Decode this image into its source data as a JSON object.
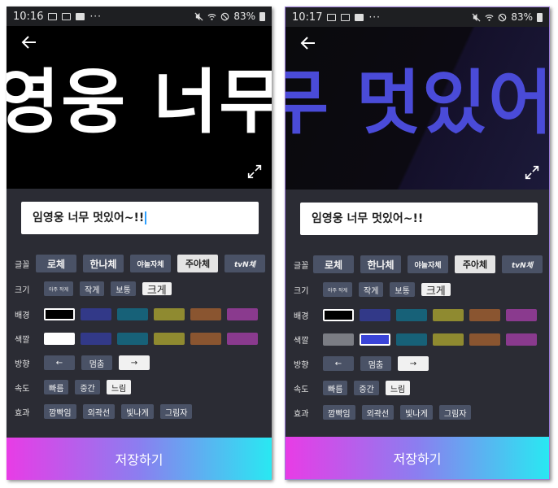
{
  "screens": [
    {
      "status_time": "10:16",
      "status_dots": "···",
      "battery": "83%",
      "preview_text": "영웅 너무",
      "input_value": "임영웅 너무 멋있어~!!",
      "rows": {
        "font_label": "글꼴",
        "size_label": "크기",
        "bg_label": "배경",
        "color_label": "색깔",
        "dir_label": "방향",
        "speed_label": "속도",
        "effect_label": "효과"
      },
      "fonts": [
        "로체",
        "한나체",
        "야놀자체",
        "주아체",
        "tvN체"
      ],
      "sizes": [
        "아주 작게",
        "작게",
        "보통",
        "크게"
      ],
      "directions": [
        "←",
        "멈춤",
        "→"
      ],
      "speeds": [
        "빠름",
        "중간",
        "느림"
      ],
      "effects": [
        "깜빡임",
        "외곽선",
        "빛나게",
        "그림자"
      ],
      "bg_colors": [
        "#000000",
        "#323988",
        "#176178",
        "#8f8a30",
        "#8a5530",
        "#8a3a8e"
      ],
      "text_colors": [
        "#ffffff",
        "#323988",
        "#176178",
        "#8f8a30",
        "#8a5530",
        "#8a3a8e"
      ],
      "save_label": "저장하기"
    },
    {
      "status_time": "10:17",
      "status_dots": "···",
      "battery": "83%",
      "preview_text": "무 멋있어",
      "input_value": "임영웅 너무 멋있어~!!",
      "rows": {
        "font_label": "글꼴",
        "size_label": "크기",
        "bg_label": "배경",
        "color_label": "색깔",
        "dir_label": "방향",
        "speed_label": "속도",
        "effect_label": "효과"
      },
      "fonts": [
        "로체",
        "한나체",
        "야놀자체",
        "주아체",
        "tvN체"
      ],
      "sizes": [
        "아주 작게",
        "작게",
        "보통",
        "크게"
      ],
      "directions": [
        "←",
        "멈춤",
        "→"
      ],
      "speeds": [
        "빠름",
        "중간",
        "느림"
      ],
      "effects": [
        "깜빡임",
        "외곽선",
        "빛나게",
        "그림자"
      ],
      "bg_colors": [
        "#000000",
        "#323988",
        "#176178",
        "#8f8a30",
        "#8a5530",
        "#8a3a8e"
      ],
      "text_colors": [
        "#7b7d84",
        "#3a44d8",
        "#176178",
        "#8f8a30",
        "#8a5530",
        "#8a3a8e"
      ],
      "save_label": "저장하기"
    }
  ],
  "accent": {
    "gradient_start": "#e83ce6",
    "gradient_end": "#29e8f2",
    "cursor": "#2ea0ff"
  },
  "icons": {
    "back": "arrow-left-icon",
    "expand": "expand-icon"
  }
}
